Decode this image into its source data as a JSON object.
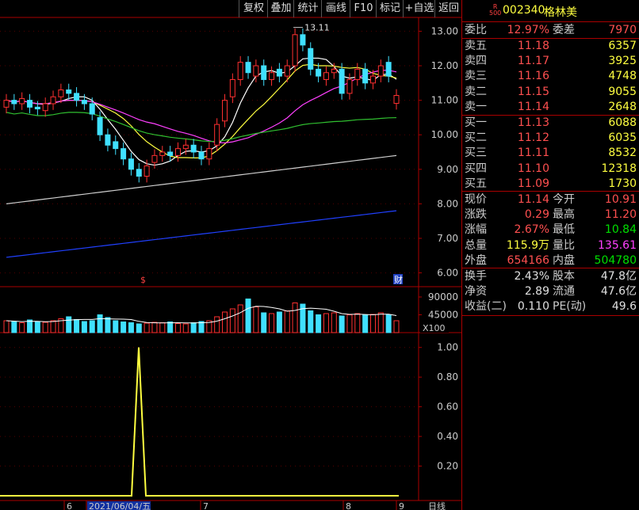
{
  "toolbar": {
    "items": [
      "复权",
      "叠加",
      "统计",
      "画线",
      "F10",
      "标记",
      "+自选",
      "返回"
    ]
  },
  "stock": {
    "badge_top": "R",
    "badge_bottom": "500",
    "code": "002340",
    "name": "格林美"
  },
  "order_ratio": {
    "wei_bi_label": "委比",
    "wei_bi": "12.97%",
    "wei_cha_label": "委差",
    "wei_cha": "7970"
  },
  "asks": [
    {
      "label": "卖五",
      "price": "11.18",
      "vol": "6357"
    },
    {
      "label": "卖四",
      "price": "11.17",
      "vol": "3925"
    },
    {
      "label": "卖三",
      "price": "11.16",
      "vol": "4748"
    },
    {
      "label": "卖二",
      "price": "11.15",
      "vol": "9055"
    },
    {
      "label": "卖一",
      "price": "11.14",
      "vol": "2648"
    }
  ],
  "bids": [
    {
      "label": "买一",
      "price": "11.13",
      "vol": "6088"
    },
    {
      "label": "买二",
      "price": "11.12",
      "vol": "6035"
    },
    {
      "label": "买三",
      "price": "11.11",
      "vol": "8532"
    },
    {
      "label": "买四",
      "price": "11.10",
      "vol": "12318"
    },
    {
      "label": "买五",
      "price": "11.09",
      "vol": "1730"
    }
  ],
  "quote": [
    {
      "l1": "现价",
      "v1": "11.14",
      "l2": "今开",
      "v2": "10.91"
    },
    {
      "l1": "涨跌",
      "v1": "0.29",
      "l2": "最高",
      "v2": "11.20"
    },
    {
      "l1": "涨幅",
      "v1": "2.67%",
      "l2": "最低",
      "v2": "10.84"
    },
    {
      "l1": "总量",
      "v1": "115.9万",
      "l2": "量比",
      "v2": "135.61"
    },
    {
      "l1": "外盘",
      "v1": "654166",
      "l2": "内盘",
      "v2": "504780"
    }
  ],
  "fundamentals": [
    {
      "l1": "换手",
      "v1": "2.43%",
      "l2": "股本",
      "v2": "47.8亿"
    },
    {
      "l1": "净资",
      "v1": "2.89",
      "l2": "流通",
      "v2": "47.6亿"
    },
    {
      "l1": "收益(二)",
      "v1": "0.110",
      "l2": "PE(动)",
      "v2": "49.6"
    }
  ],
  "markers": {
    "dividend": "$",
    "finance": "财"
  },
  "chart_data": [
    {
      "type": "candlestick",
      "price_axis_ticks": [
        "13.00",
        "12.00",
        "11.00",
        "10.00",
        "9.00",
        "8.00",
        "7.00",
        "6.00"
      ],
      "ylim": [
        5.6,
        13.4
      ],
      "high_annotation": "13.11",
      "closes": [
        11.0,
        10.9,
        11.05,
        10.8,
        10.75,
        10.9,
        11.1,
        11.3,
        11.2,
        11.0,
        10.9,
        10.6,
        10.0,
        9.7,
        9.6,
        9.3,
        9.0,
        8.8,
        9.1,
        9.4,
        9.5,
        9.4,
        9.6,
        9.7,
        9.5,
        9.3,
        9.6,
        10.3,
        11.0,
        11.6,
        12.1,
        11.8,
        12.0,
        11.6,
        11.8,
        11.7,
        12.0,
        12.9,
        12.6,
        11.9,
        11.7,
        11.8,
        11.9,
        11.2,
        11.6,
        11.9,
        11.5,
        11.7,
        12.0,
        11.7,
        11.14
      ],
      "opens": [
        10.8,
        11.0,
        10.9,
        11.0,
        10.8,
        10.7,
        10.9,
        11.1,
        11.3,
        11.2,
        11.0,
        10.9,
        10.5,
        10.0,
        9.8,
        9.6,
        9.3,
        9.0,
        8.8,
        9.2,
        9.4,
        9.5,
        9.4,
        9.6,
        9.7,
        9.5,
        9.3,
        9.7,
        10.4,
        11.1,
        11.6,
        12.1,
        11.7,
        12.0,
        11.6,
        11.9,
        11.7,
        12.0,
        12.9,
        12.5,
        11.9,
        11.6,
        11.8,
        11.9,
        11.2,
        11.6,
        11.9,
        11.5,
        11.7,
        12.1,
        10.91
      ]
    },
    {
      "type": "bar",
      "title": "volume",
      "axis_ticks": [
        "90000",
        "45000"
      ],
      "unit": "X100",
      "ylim": [
        0,
        110000
      ],
      "values": [
        30000,
        28000,
        25000,
        32000,
        27000,
        26000,
        30000,
        35000,
        40000,
        33000,
        28000,
        30000,
        45000,
        38000,
        30000,
        27000,
        25000,
        22000,
        24000,
        26000,
        25000,
        27000,
        23000,
        22000,
        25000,
        28000,
        30000,
        40000,
        52000,
        60000,
        70000,
        85000,
        65000,
        50000,
        48000,
        52000,
        55000,
        75000,
        72000,
        55000,
        45000,
        48000,
        50000,
        42000,
        45000,
        48000,
        44000,
        46000,
        50000,
        45000,
        30000
      ]
    },
    {
      "type": "line",
      "axis_ticks": [
        "1.00",
        "0.80",
        "0.60",
        "0.40",
        "0.20"
      ],
      "ylim": [
        0,
        1.1
      ],
      "spike_index": 13,
      "spike_value": 1.0
    }
  ],
  "date_axis": {
    "labels": [
      "6",
      "2021/06/04/五",
      "7",
      "8",
      "9"
    ],
    "period": "日线"
  }
}
